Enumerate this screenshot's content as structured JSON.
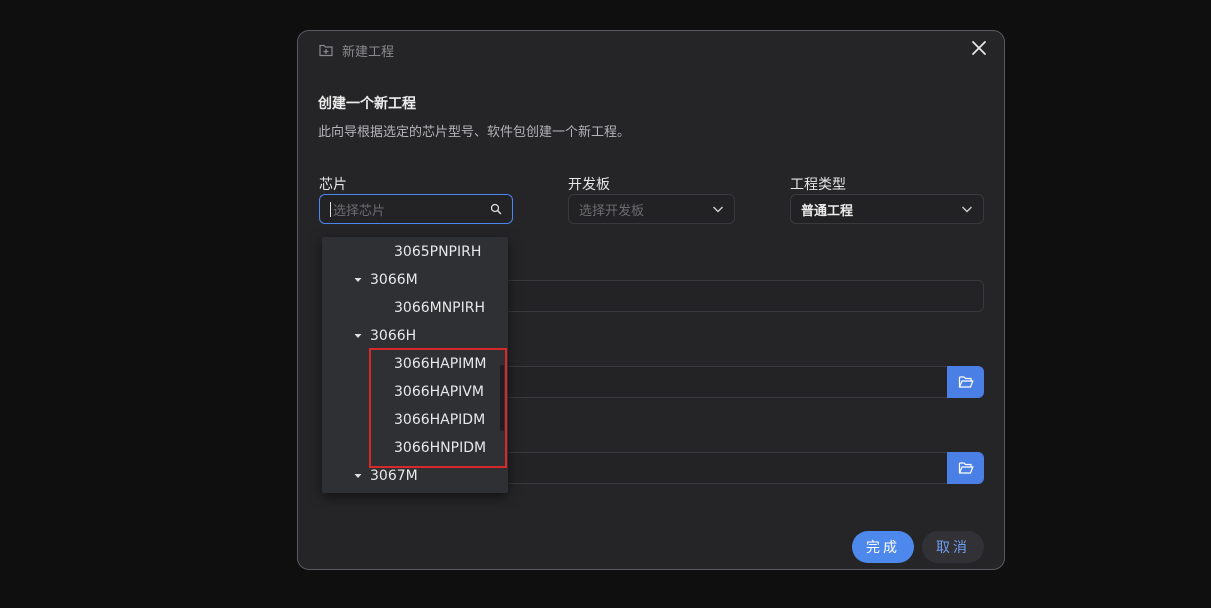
{
  "dialog": {
    "title": "新建工程",
    "heading": "创建一个新工程",
    "description": "此向导根据选定的芯片型号、软件包创建一个新工程。"
  },
  "fields": {
    "chip": {
      "label": "芯片",
      "placeholder": "选择芯片"
    },
    "board": {
      "label": "开发板",
      "placeholder": "选择开发板"
    },
    "project_type": {
      "label": "工程类型",
      "value": "普通工程"
    }
  },
  "chip_dropdown": {
    "items": [
      {
        "label": "3065PNPIRH",
        "level": 2
      },
      {
        "label": "3066M",
        "level": 1,
        "expanded": true
      },
      {
        "label": "3066MNPIRH",
        "level": 2
      },
      {
        "label": "3066H",
        "level": 1,
        "expanded": true
      },
      {
        "label": "3066HAPIMM",
        "level": 2
      },
      {
        "label": "3066HAPIVM",
        "level": 2
      },
      {
        "label": "3066HAPIDM",
        "level": 2
      },
      {
        "label": "3066HNPIDM",
        "level": 2
      },
      {
        "label": "3067M",
        "level": 1,
        "expanded": true
      }
    ]
  },
  "buttons": {
    "finish": "完成",
    "cancel": "取消"
  },
  "colors": {
    "accent": "#4d88ec",
    "highlight_border": "#d62a2a",
    "dialog_bg": "#252527"
  },
  "icons": [
    "new-project-icon",
    "close-icon",
    "search-icon",
    "chevron-down-icon",
    "folder-open-icon",
    "caret-down-icon"
  ]
}
